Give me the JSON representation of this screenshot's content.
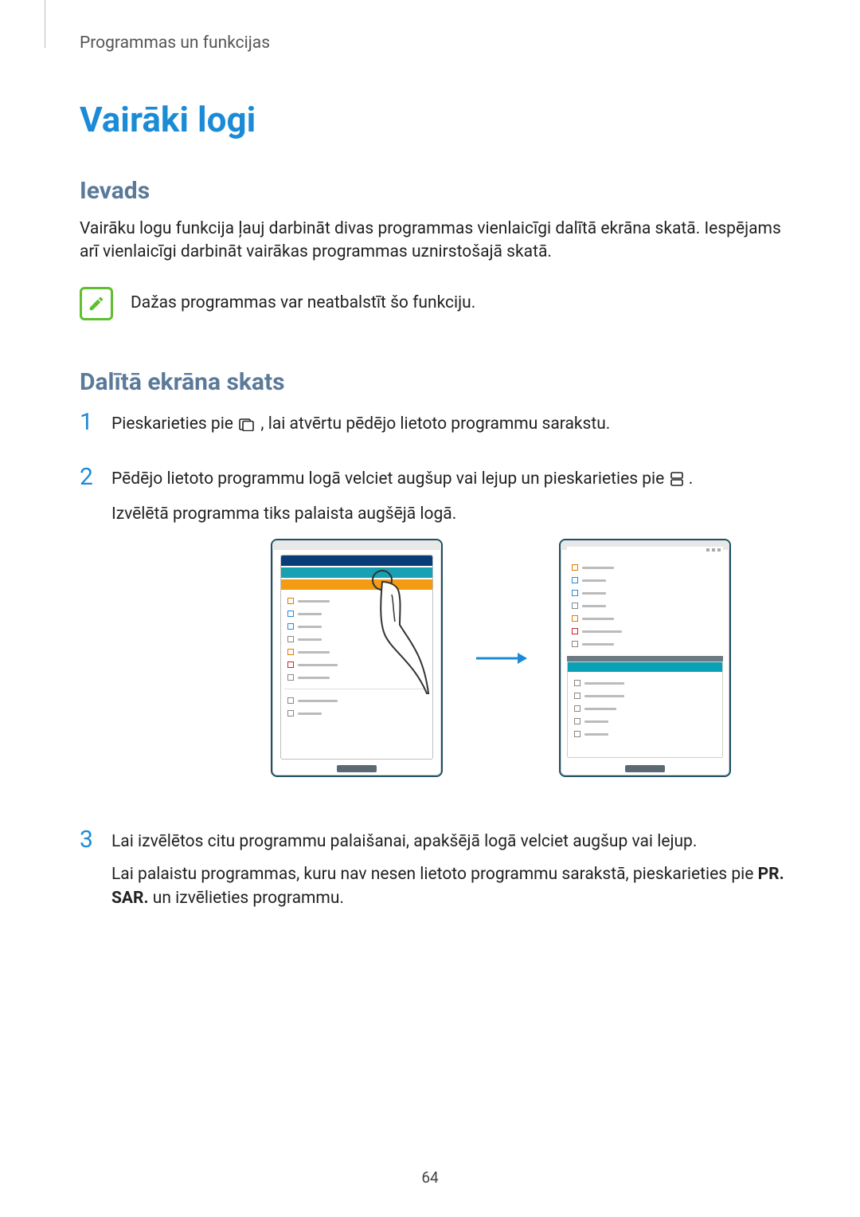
{
  "breadcrumb": "Programmas un funkcijas",
  "title": "Vairāki logi",
  "intro": {
    "heading": "Ievads",
    "text": "Vairāku logu funkcija ļauj darbināt divas programmas vienlaicīgi dalītā ekrāna skatā. Iespējams arī vienlaicīgi darbināt vairākas programmas uznirstošajā skatā."
  },
  "note": {
    "icon": "note-icon",
    "text": "Dažas programmas var neatbalstīt šo funkciju."
  },
  "split": {
    "heading": "Dalītā ekrāna skats"
  },
  "steps": {
    "s1": {
      "num": "1",
      "before_icon": "Pieskarieties pie ",
      "after_icon": ", lai atvērtu pēdējo lietoto programmu sarakstu.",
      "icon": "recents-icon"
    },
    "s2": {
      "num": "2",
      "line1_before": "Pēdējo lietoto programmu logā velciet augšup vai lejup un pieskarieties pie ",
      "line1_after": ".",
      "icon": "split-icon",
      "line2": "Izvēlētā programma tiks palaista augšējā logā."
    },
    "s3": {
      "num": "3",
      "line1": "Lai izvēlētos citu programmu palaišanai, apakšējā logā velciet augšup vai lejup.",
      "line2_a": "Lai palaistu programmas, kuru nav nesen lietoto programmu sarakstā, pieskarieties pie ",
      "line2_bold": "PR. SAR.",
      "line2_b": " un izvēlieties programmu."
    }
  },
  "page_number": "64"
}
